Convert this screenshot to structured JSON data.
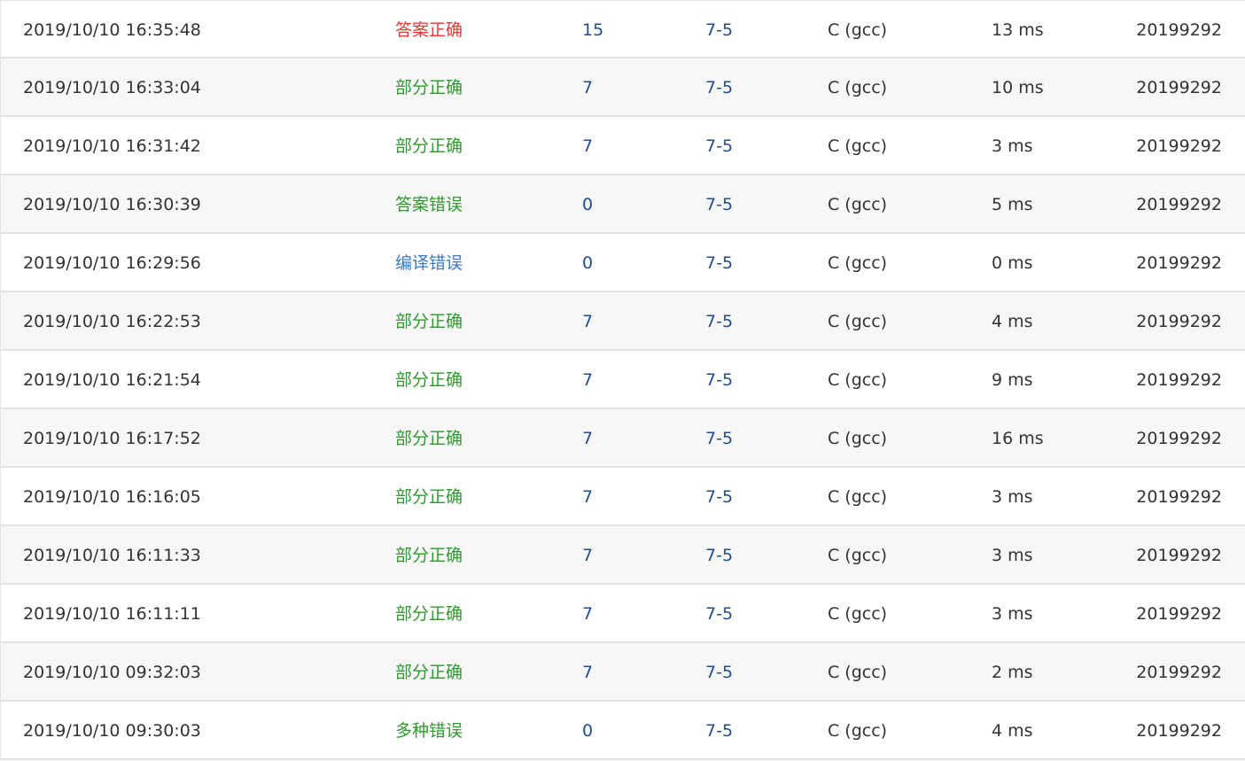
{
  "colors": {
    "answer_correct": "#e53935",
    "partial_correct": "#2e9a2e",
    "answer_wrong": "#2e9a2e",
    "compile_error": "#3a7ac8",
    "multiple_errors": "#2e9a2e",
    "link": "#1f4e8f"
  },
  "submissions": [
    {
      "time": "2019/10/10 16:35:48",
      "status": "答案正确",
      "status_key": "answer_correct",
      "score": "15",
      "problem": "7-5",
      "language": "C (gcc)",
      "runtime": "13 ms",
      "user": "20199292"
    },
    {
      "time": "2019/10/10 16:33:04",
      "status": "部分正确",
      "status_key": "partial_correct",
      "score": "7",
      "problem": "7-5",
      "language": "C (gcc)",
      "runtime": "10 ms",
      "user": "20199292"
    },
    {
      "time": "2019/10/10 16:31:42",
      "status": "部分正确",
      "status_key": "partial_correct",
      "score": "7",
      "problem": "7-5",
      "language": "C (gcc)",
      "runtime": "3 ms",
      "user": "20199292"
    },
    {
      "time": "2019/10/10 16:30:39",
      "status": "答案错误",
      "status_key": "answer_wrong",
      "score": "0",
      "problem": "7-5",
      "language": "C (gcc)",
      "runtime": "5 ms",
      "user": "20199292"
    },
    {
      "time": "2019/10/10 16:29:56",
      "status": "编译错误",
      "status_key": "compile_error",
      "score": "0",
      "problem": "7-5",
      "language": "C (gcc)",
      "runtime": "0 ms",
      "user": "20199292"
    },
    {
      "time": "2019/10/10 16:22:53",
      "status": "部分正确",
      "status_key": "partial_correct",
      "score": "7",
      "problem": "7-5",
      "language": "C (gcc)",
      "runtime": "4 ms",
      "user": "20199292"
    },
    {
      "time": "2019/10/10 16:21:54",
      "status": "部分正确",
      "status_key": "partial_correct",
      "score": "7",
      "problem": "7-5",
      "language": "C (gcc)",
      "runtime": "9 ms",
      "user": "20199292"
    },
    {
      "time": "2019/10/10 16:17:52",
      "status": "部分正确",
      "status_key": "partial_correct",
      "score": "7",
      "problem": "7-5",
      "language": "C (gcc)",
      "runtime": "16 ms",
      "user": "20199292"
    },
    {
      "time": "2019/10/10 16:16:05",
      "status": "部分正确",
      "status_key": "partial_correct",
      "score": "7",
      "problem": "7-5",
      "language": "C (gcc)",
      "runtime": "3 ms",
      "user": "20199292"
    },
    {
      "time": "2019/10/10 16:11:33",
      "status": "部分正确",
      "status_key": "partial_correct",
      "score": "7",
      "problem": "7-5",
      "language": "C (gcc)",
      "runtime": "3 ms",
      "user": "20199292"
    },
    {
      "time": "2019/10/10 16:11:11",
      "status": "部分正确",
      "status_key": "partial_correct",
      "score": "7",
      "problem": "7-5",
      "language": "C (gcc)",
      "runtime": "3 ms",
      "user": "20199292"
    },
    {
      "time": "2019/10/10 09:32:03",
      "status": "部分正确",
      "status_key": "partial_correct",
      "score": "7",
      "problem": "7-5",
      "language": "C (gcc)",
      "runtime": "2 ms",
      "user": "20199292"
    },
    {
      "time": "2019/10/10 09:30:03",
      "status": "多种错误",
      "status_key": "multiple_errors",
      "score": "0",
      "problem": "7-5",
      "language": "C (gcc)",
      "runtime": "4 ms",
      "user": "20199292"
    }
  ]
}
